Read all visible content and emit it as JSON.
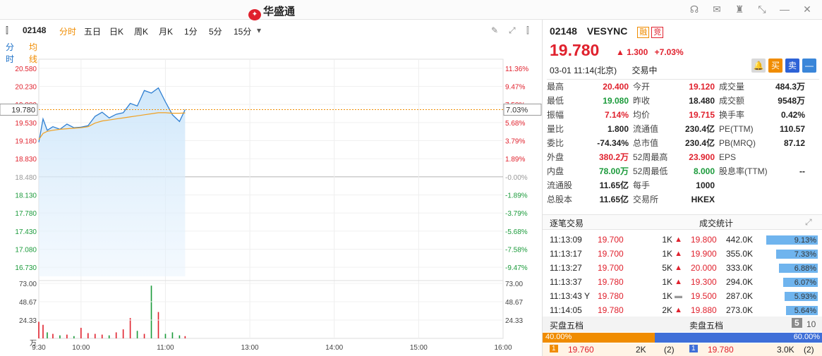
{
  "title_bar": {
    "app_name": "华盛通",
    "logo_mark": "✦",
    "buttons": [
      "headset-icon",
      "mail-icon",
      "shirt-icon",
      "collapse-icon",
      "maximize-icon",
      "close-icon"
    ]
  },
  "toolbar": {
    "code": "02148",
    "tabs": [
      "分时",
      "五日",
      "日K",
      "周K",
      "月K",
      "1分",
      "5分",
      "15分"
    ],
    "active_tab": "分时",
    "more": "▾"
  },
  "subtabs": {
    "minute": "分时",
    "avg": "均线"
  },
  "chart_data": {
    "type": "line",
    "title": "",
    "prev_close": 18.48,
    "current_price_label": "19.780",
    "price_ticks": [
      "20.580",
      "20.230",
      "19.880",
      "19.530",
      "19.180",
      "18.830",
      "18.480",
      "18.130",
      "17.780",
      "17.430",
      "17.080",
      "16.730"
    ],
    "pct_ticks": [
      "11.36%",
      "9.47%",
      "7.58%",
      "5.68%",
      "3.79%",
      "1.89%",
      "-0.00%",
      "-1.89%",
      "-3.79%",
      "-5.68%",
      "-7.58%",
      "-9.47%"
    ],
    "current_pct_label": "7.03%",
    "ylim": [
      16.555,
      20.755
    ],
    "x_labels": [
      "9:30",
      "10:00",
      "11:00",
      "13:00",
      "14:00",
      "15:00",
      "16:00"
    ],
    "volume_ticks": [
      "73.00",
      "48.67",
      "24.33",
      "万"
    ],
    "volume_ylim": [
      0,
      73
    ],
    "series": [
      {
        "name": "分时",
        "x": [
          "9:30",
          "9:33",
          "9:36",
          "9:40",
          "9:45",
          "9:50",
          "9:55",
          "10:00",
          "10:05",
          "10:10",
          "10:15",
          "10:20",
          "10:25",
          "10:30",
          "10:35",
          "10:40",
          "10:45",
          "10:50",
          "10:55",
          "11:00",
          "11:05",
          "11:10",
          "11:14"
        ],
        "values": [
          19.15,
          19.6,
          19.38,
          19.45,
          19.4,
          19.5,
          19.43,
          19.44,
          19.47,
          19.65,
          19.73,
          19.62,
          19.69,
          19.72,
          19.9,
          19.85,
          20.15,
          20.1,
          20.2,
          19.93,
          19.68,
          19.55,
          19.78
        ]
      },
      {
        "name": "均线",
        "x": [
          "9:30",
          "9:33",
          "9:36",
          "9:40",
          "9:45",
          "9:50",
          "9:55",
          "10:00",
          "10:05",
          "10:10",
          "10:15",
          "10:20",
          "10:25",
          "10:30",
          "10:35",
          "10:40",
          "10:45",
          "10:50",
          "10:55",
          "11:00",
          "11:05",
          "11:10",
          "11:14"
        ],
        "values": [
          19.2,
          19.32,
          19.36,
          19.38,
          19.4,
          19.41,
          19.42,
          19.43,
          19.45,
          19.52,
          19.56,
          19.58,
          19.6,
          19.62,
          19.64,
          19.66,
          19.68,
          19.7,
          19.72,
          19.72,
          19.71,
          19.71,
          19.715
        ]
      }
    ],
    "volume": {
      "x": [
        "9:30",
        "9:33",
        "9:36",
        "9:40",
        "9:45",
        "9:50",
        "9:55",
        "10:00",
        "10:05",
        "10:10",
        "10:15",
        "10:20",
        "10:25",
        "10:30",
        "10:35",
        "10:40",
        "10:45",
        "10:50",
        "10:55",
        "11:00",
        "11:05",
        "11:10",
        "11:14"
      ],
      "values": [
        22,
        18,
        8,
        6,
        4,
        5,
        3,
        14,
        7,
        6,
        5,
        4,
        8,
        12,
        27,
        10,
        6,
        70,
        35,
        6,
        8,
        4,
        3
      ]
    }
  },
  "stock": {
    "code": "02148",
    "name": "VESYNC",
    "badge1": "融",
    "badge2": "竞",
    "price": "19.780",
    "arrow": "▲",
    "change": "1.300",
    "change_pct": "+7.03%",
    "datetime": "03-01 11:14(北京)",
    "status": "交易中",
    "buttons": {
      "alert": "🔔",
      "buy": "买",
      "sell": "卖",
      "minus": "—"
    }
  },
  "quote": [
    [
      "最高",
      "20.400",
      "今开",
      "19.120",
      "成交量",
      "484.3万"
    ],
    [
      "最低",
      "19.080",
      "昨收",
      "18.480",
      "成交额",
      "9548万"
    ],
    [
      "振幅",
      "7.14%",
      "均价",
      "19.715",
      "换手率",
      "0.42%"
    ],
    [
      "量比",
      "1.800",
      "流通值",
      "230.4亿",
      "PE(TTM)",
      "110.57"
    ],
    [
      "委比",
      "-74.34%",
      "总市值",
      "230.4亿",
      "PB(MRQ)",
      "87.12"
    ],
    [
      "外盘",
      "380.2万",
      "52周最高",
      "23.900",
      "EPS",
      ""
    ],
    [
      "内盘",
      "78.00万",
      "52周最低",
      "8.000",
      "股息率(TTM)",
      "--"
    ],
    [
      "流通股",
      "11.65亿",
      "每手",
      "1000",
      "",
      ""
    ],
    [
      "总股本",
      "11.65亿",
      "交易所",
      "HKEX",
      "",
      ""
    ]
  ],
  "trade_tabs": {
    "ticks": "逐笔交易",
    "stats": "成交统计",
    "expand": "expand-icon"
  },
  "ticks": [
    [
      "11:13:09",
      "19.700",
      "1K",
      "▲"
    ],
    [
      "11:13:17",
      "19.700",
      "1K",
      "▲"
    ],
    [
      "11:13:27",
      "19.700",
      "5K",
      "▲"
    ],
    [
      "11:13:37",
      "19.780",
      "1K",
      "▲"
    ],
    [
      "11:13:43 Y",
      "19.780",
      "1K",
      "▬"
    ],
    [
      "11:14:05",
      "19.780",
      "2K",
      "▲"
    ]
  ],
  "stats": [
    [
      "19.800",
      "442.0K",
      "9.13%",
      9.13
    ],
    [
      "19.900",
      "355.0K",
      "7.33%",
      7.33
    ],
    [
      "20.000",
      "333.0K",
      "6.88%",
      6.88
    ],
    [
      "19.300",
      "294.0K",
      "6.07%",
      6.07
    ],
    [
      "19.500",
      "287.0K",
      "5.93%",
      5.93
    ],
    [
      "19.880",
      "273.0K",
      "5.64%",
      5.64
    ]
  ],
  "book": {
    "buy_label": "买盘五档",
    "sell_label": "卖盘五档",
    "level5": "5",
    "level10": "10",
    "buy_pct": "40.00%",
    "sell_pct": "60.00%",
    "buy_share": 40,
    "bid_level": "1",
    "bid_price": "19.760",
    "bid_vol": "2K",
    "bid_orders": "(2)",
    "ask_level": "1",
    "ask_price": "19.780",
    "ask_vol": "3.0K",
    "ask_orders": "(2)"
  }
}
